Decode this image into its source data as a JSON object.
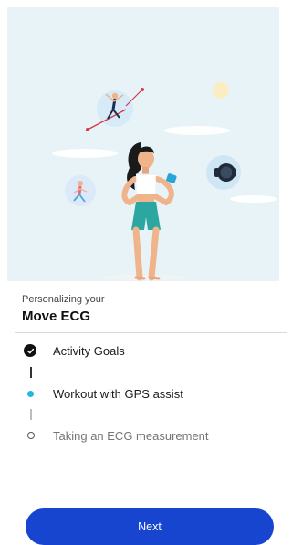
{
  "onboarding": {
    "subtitle": "Personalizing your",
    "title": "Move ECG",
    "steps": [
      {
        "label": "Activity Goals",
        "status": "complete"
      },
      {
        "label": "Workout with GPS assist",
        "status": "active"
      },
      {
        "label": "Taking an ECG measurement",
        "status": "pending"
      }
    ],
    "next_button_label": "Next"
  },
  "colors": {
    "primary_button": "#1745cf",
    "active_step": "#27b4e5",
    "hero_background": "#e8f3f8",
    "complete_step": "#111111",
    "pending_text": "#757575"
  },
  "illustration": {
    "icons": [
      "woman-with-smartwatch-illustration",
      "running-woman-bubble",
      "jumping-figure-bubble",
      "smartwatch-bubble",
      "sun-icon",
      "clouds"
    ]
  }
}
